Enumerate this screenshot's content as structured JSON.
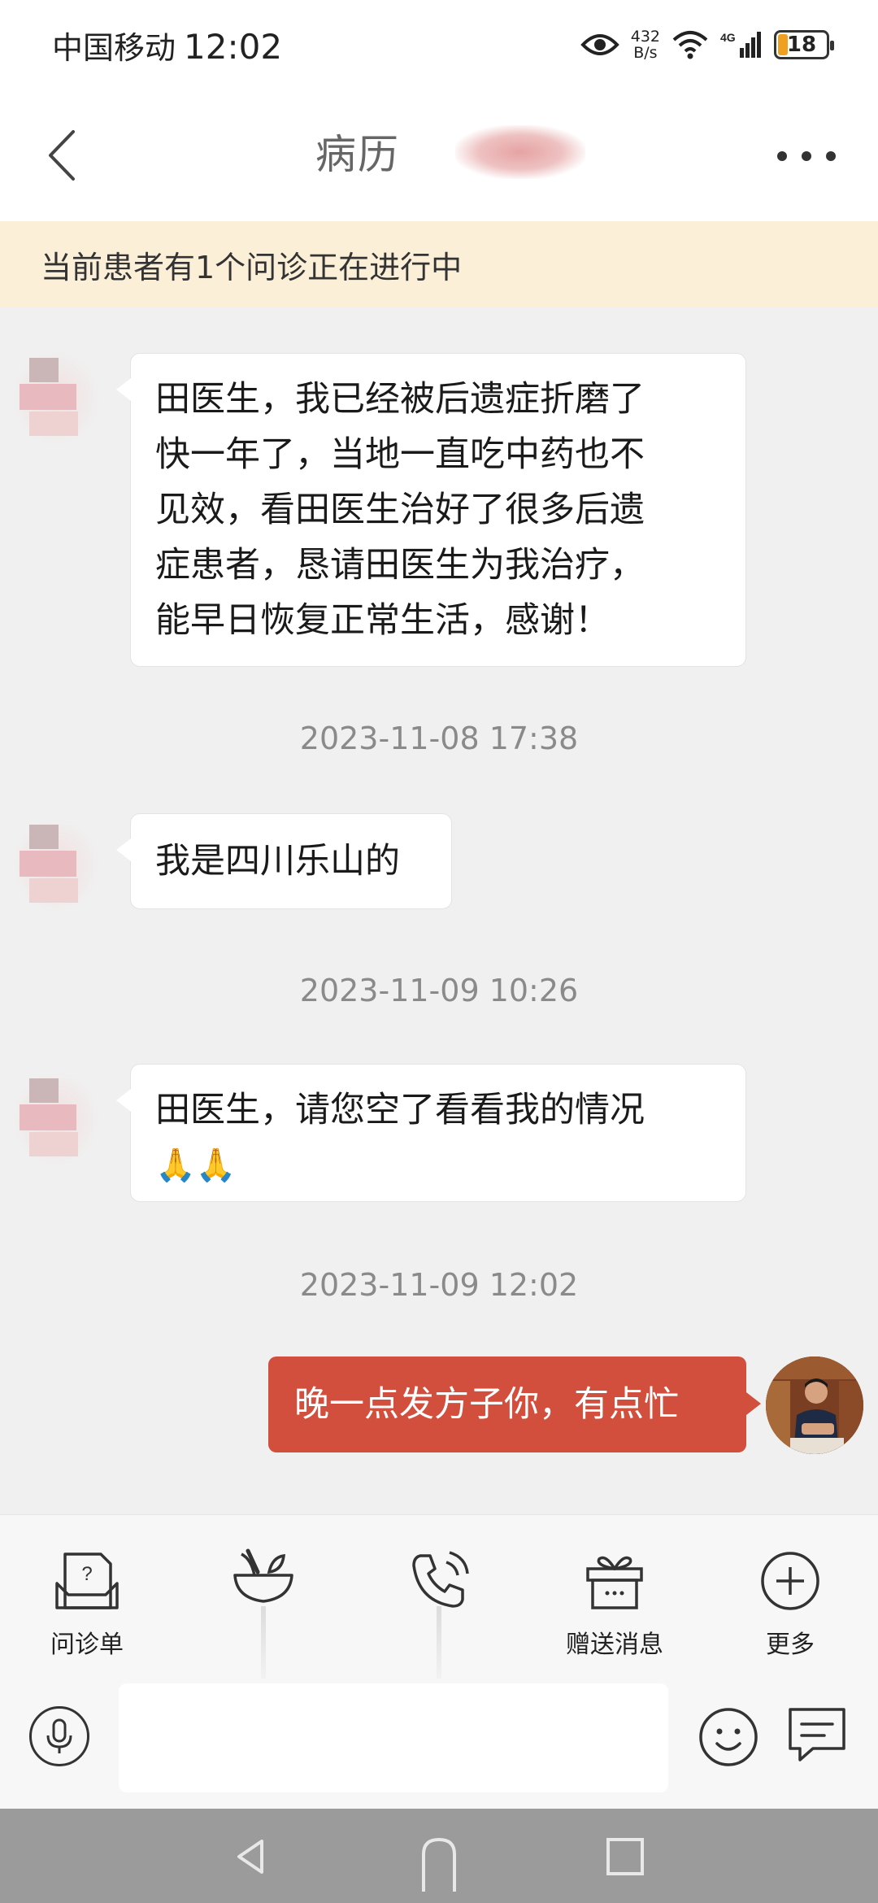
{
  "status_bar": {
    "carrier": "中国移动",
    "time": "12:02",
    "net_speed_value": "432",
    "net_speed_unit": "B/s",
    "network": "4G",
    "battery": "18"
  },
  "header": {
    "title": "病历"
  },
  "notice": {
    "text": "当前患者有1个问诊正在进行中"
  },
  "messages": [
    {
      "direction": "in",
      "lines": [
        "田医生，我已经被后遗症折磨了",
        "快一年了，当地一直吃中药也不",
        "见效，看田医生治好了很多后遗",
        "症患者，恳请田医生为我治疗，",
        "能早日恢复正常生活，感谢！"
      ]
    },
    {
      "timestamp": "2023-11-08 17:38"
    },
    {
      "direction": "in",
      "text": "我是四川乐山的"
    },
    {
      "timestamp": "2023-11-09 10:26"
    },
    {
      "direction": "in",
      "text": "田医生，请您空了看看我的情况",
      "emoji": "🙏🙏"
    },
    {
      "timestamp": "2023-11-09 12:02"
    },
    {
      "direction": "out",
      "text": "晚一点发方子你，有点忙"
    }
  ],
  "toolbar": {
    "items": [
      {
        "label": "问诊单",
        "icon": "questionnaire-icon"
      },
      {
        "label": "",
        "icon": "herb-bowl-icon"
      },
      {
        "label": "",
        "icon": "phone-call-icon"
      },
      {
        "label": "赠送消息",
        "icon": "gift-icon"
      },
      {
        "label": "更多",
        "icon": "plus-circle-icon"
      }
    ]
  },
  "input": {
    "value": "",
    "placeholder": ""
  },
  "colors": {
    "accent": "#d24f3d",
    "notice_bg": "#fbefd8",
    "chat_bg": "#f0f0f0"
  }
}
